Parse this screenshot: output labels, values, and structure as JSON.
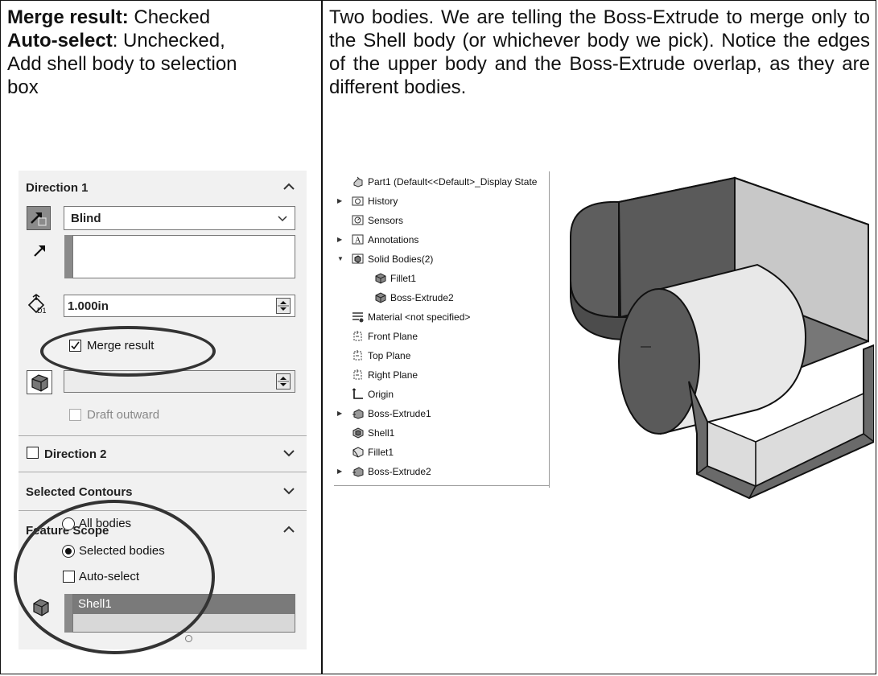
{
  "left_cell": {
    "line1_bold": "Merge result:",
    "line1_rest": " Checked",
    "line2_bold": "Auto-select",
    "line2_rest": ": Unchecked,",
    "line3": "Add shell body to selection",
    "line4": "box"
  },
  "right_cell": {
    "text": "Two bodies. We are telling the Boss-Extrude to merge only to the Shell body (or whichever body we pick). Notice the edges of the upper body and the Boss-Extrude overlap, as they are different bodies."
  },
  "property_manager": {
    "direction1": {
      "title": "Direction 1",
      "end_condition": "Blind",
      "depth": "1.000in",
      "depth_icon_label": "D1",
      "merge_result_label": "Merge result",
      "merge_result_checked": true,
      "draft_outward_label": "Draft outward",
      "draft_outward_checked": false
    },
    "direction2": {
      "title": "Direction 2",
      "checked": false
    },
    "selected_contours": {
      "title": "Selected Contours"
    },
    "feature_scope": {
      "title": "Feature Scope",
      "options": [
        "All bodies",
        "Selected bodies"
      ],
      "selected_option": "Selected bodies",
      "auto_select_label": "Auto-select",
      "auto_select_checked": false,
      "selected_body": "Shell1"
    }
  },
  "feature_tree": {
    "root": "Part1  (Default<<Default>_Display State",
    "items": [
      {
        "label": "History",
        "icon": "history-icon",
        "expandable": true
      },
      {
        "label": "Sensors",
        "icon": "sensor-icon",
        "expandable": false
      },
      {
        "label": "Annotations",
        "icon": "annotation-icon",
        "expandable": true
      },
      {
        "label": "Solid Bodies(2)",
        "icon": "solid-bodies-icon",
        "expandable": true,
        "expanded": true
      },
      {
        "label": "Fillet1",
        "icon": "body-icon",
        "child": true
      },
      {
        "label": "Boss-Extrude2",
        "icon": "body-icon",
        "child": true
      },
      {
        "label": "Material <not specified>",
        "icon": "material-icon",
        "expandable": false
      },
      {
        "label": "Front Plane",
        "icon": "plane-icon",
        "expandable": false
      },
      {
        "label": "Top Plane",
        "icon": "plane-icon",
        "expandable": false
      },
      {
        "label": "Right Plane",
        "icon": "plane-icon",
        "expandable": false
      },
      {
        "label": "Origin",
        "icon": "origin-icon",
        "expandable": false
      },
      {
        "label": "Boss-Extrude1",
        "icon": "extrude-icon",
        "expandable": true
      },
      {
        "label": "Shell1",
        "icon": "shell-icon",
        "expandable": false
      },
      {
        "label": "Fillet1",
        "icon": "fillet-icon",
        "expandable": false
      },
      {
        "label": "Boss-Extrude2",
        "icon": "extrude-icon",
        "expandable": true
      }
    ]
  },
  "colors": {
    "panel_bg": "#f1f1f1",
    "highlight": "#8b8b8b",
    "selected_row": "#7a7a7a"
  }
}
